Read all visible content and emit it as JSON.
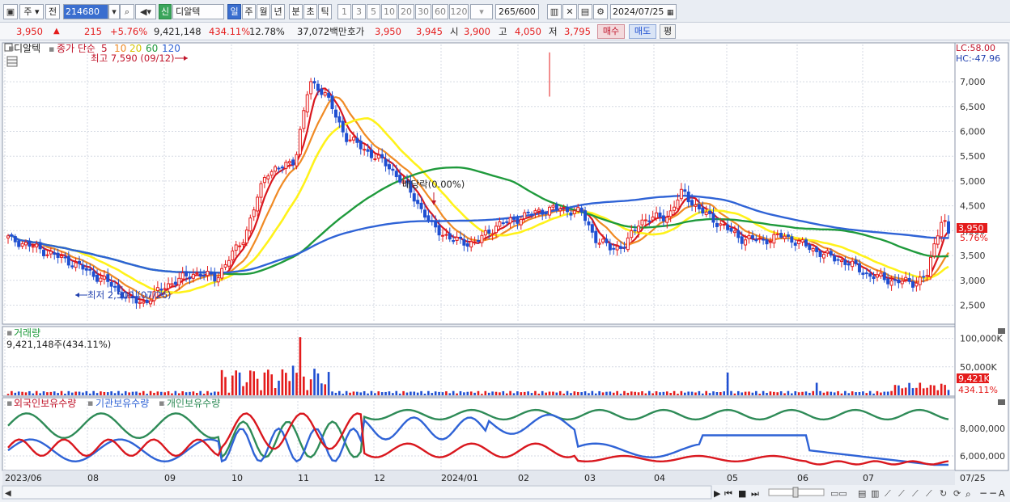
{
  "toolbar": {
    "market": "주",
    "prev": "전",
    "code": "214680",
    "sin": "신",
    "name": "디알텍",
    "periods": [
      "일",
      "주",
      "월",
      "년",
      "분",
      "초",
      "틱"
    ],
    "intervals": [
      "1",
      "3",
      "5",
      "10",
      "20",
      "30",
      "60",
      "120"
    ],
    "count": "265",
    "count_total": "/600",
    "date": "2024/07/25"
  },
  "quote": {
    "price": "3,950",
    "arrow": "▲",
    "change": "215",
    "change_pct": "+5.76%",
    "volume": "9,421,148",
    "vol_pct": "434.11%",
    "turnover": "12.78%",
    "amount": "37,072백만",
    "hoga_label": "호가",
    "ask": "3,950",
    "bid": "3,945",
    "open_label": "시",
    "open": "3,900",
    "high_label": "고",
    "high": "4,050",
    "low_label": "저",
    "low": "3,795",
    "buy_btn": "매수",
    "sell_btn": "매도",
    "avg_btn": "평"
  },
  "price_panel": {
    "stock_name": "디알텍",
    "indicator": "종가 단순",
    "ma_labels": [
      "5",
      "10",
      "20",
      "60",
      "120"
    ],
    "high_note": "최고 7,590 (09/12)",
    "low_note": "최저 2,500 (07/26)",
    "dividend_note": "배당락(0.00%)",
    "lc": "LC:58.00",
    "hc": "HC:-47.96",
    "current_price_tag": "3,950",
    "current_pct_tag": "5.76%"
  },
  "volume_panel": {
    "title": "거래량",
    "info": "9,421,148주(434.11%)",
    "current_tag": "9,421K",
    "current_pct": "434.11%"
  },
  "holdings_panel": {
    "legend": [
      "외국인보유수량",
      "기관보유수량",
      "개인보유수량"
    ]
  },
  "colors": {
    "up": "#e41b1b",
    "down": "#1f4fd1",
    "ma5": "#d9171e",
    "ma10": "#f08a24",
    "ma20": "#fff21a",
    "ma60": "#1f9a3c",
    "ma120": "#2f63d6",
    "foreign": "#d9171e",
    "institution": "#2f63d6",
    "individual": "#2e8b57"
  },
  "chart_data": [
    {
      "type": "candlestick",
      "title": "디알텍",
      "x_tick_labels": [
        "2023/06",
        "08",
        "09",
        "10",
        "11",
        "12",
        "2024/01",
        "02",
        "03",
        "04",
        "05",
        "06",
        "07",
        "07/25"
      ],
      "y_ticks": [
        2500,
        3000,
        3500,
        4000,
        4500,
        5000,
        5500,
        6000,
        6500,
        7000
      ],
      "ylim": [
        2150,
        7750
      ],
      "key_points": [
        {
          "date": "2023/06",
          "close": 3850
        },
        {
          "date": "2023/07/26",
          "close": 2500,
          "note": "최저"
        },
        {
          "date": "2023/08",
          "close": 3100
        },
        {
          "date": "2023/08 late",
          "close": 5300
        },
        {
          "date": "2023/09/12",
          "close": 7000,
          "high": 7590,
          "note": "최고"
        },
        {
          "date": "2023/10",
          "close": 5000
        },
        {
          "date": "2023/11",
          "close": 3900
        },
        {
          "date": "2023/12",
          "close": 3650
        },
        {
          "date": "2024/01",
          "close": 4500
        },
        {
          "date": "2024/02",
          "close": 3850
        },
        {
          "date": "2024/03",
          "close": 3550
        },
        {
          "date": "2024/04",
          "close": 3000
        },
        {
          "date": "2024/05",
          "close": 4150
        },
        {
          "date": "2024/06",
          "close": 3600
        },
        {
          "date": "2024/07/25",
          "open": 3900,
          "high": 4050,
          "low": 3795,
          "close": 3950
        }
      ]
    },
    {
      "type": "bar",
      "title": "거래량",
      "y_ticks": [
        50000000,
        100000000
      ],
      "y_tick_labels": [
        "50,000K",
        "100,000K"
      ],
      "last_value": 9421148
    },
    {
      "type": "line",
      "title": "보유수량",
      "series_names": [
        "외국인보유수량",
        "기관보유수량",
        "개인보유수량"
      ],
      "y_ticks": [
        6000000,
        8000000
      ],
      "y_tick_labels": [
        "6,000,000",
        "8,000,000"
      ]
    }
  ]
}
